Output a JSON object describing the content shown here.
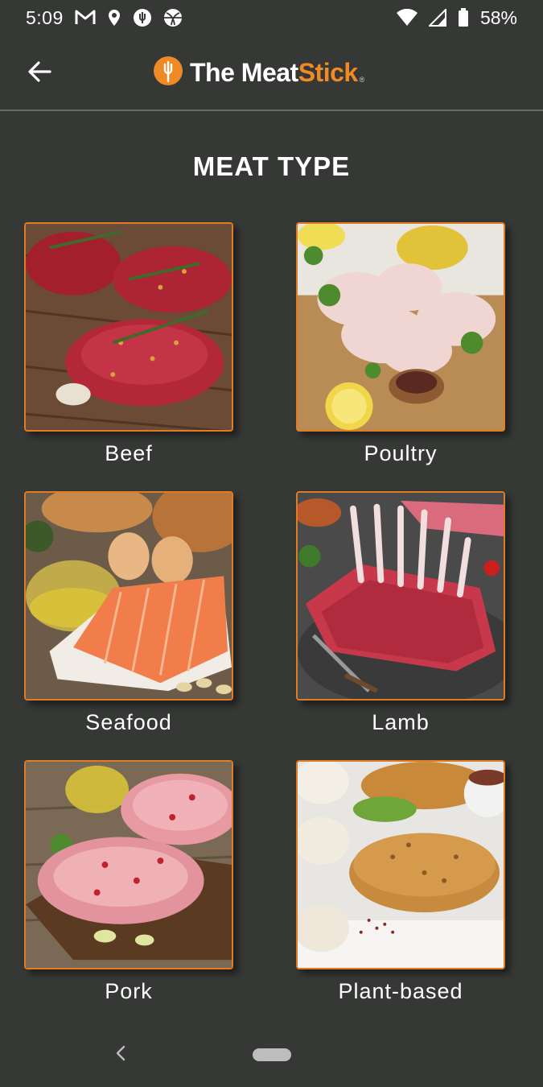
{
  "status_bar": {
    "time": "5:09",
    "battery": "58%",
    "icons": [
      "gmail-icon",
      "location-icon",
      "meatstick-notification-icon",
      "sports-icon",
      "wifi-icon",
      "signal-icon",
      "battery-icon"
    ]
  },
  "app_bar": {
    "back_icon": "arrow-left-icon",
    "brand_prefix": "The Meat",
    "brand_accent": "Stick",
    "brand_reg": "®",
    "logo_icon": "meatstick-logo-icon"
  },
  "page": {
    "title": "MEAT TYPE"
  },
  "meat_types": [
    {
      "label": "Beef"
    },
    {
      "label": "Poultry"
    },
    {
      "label": "Seafood"
    },
    {
      "label": "Lamb"
    },
    {
      "label": "Pork"
    },
    {
      "label": "Plant-based"
    }
  ],
  "colors": {
    "background": "#363836",
    "accent": "#ef8a27",
    "tile_border": "#e07b26",
    "divider": "#6a6c6a"
  },
  "nav_bar": {
    "back_icon": "nav-back-icon",
    "home_icon": "nav-home-pill"
  }
}
